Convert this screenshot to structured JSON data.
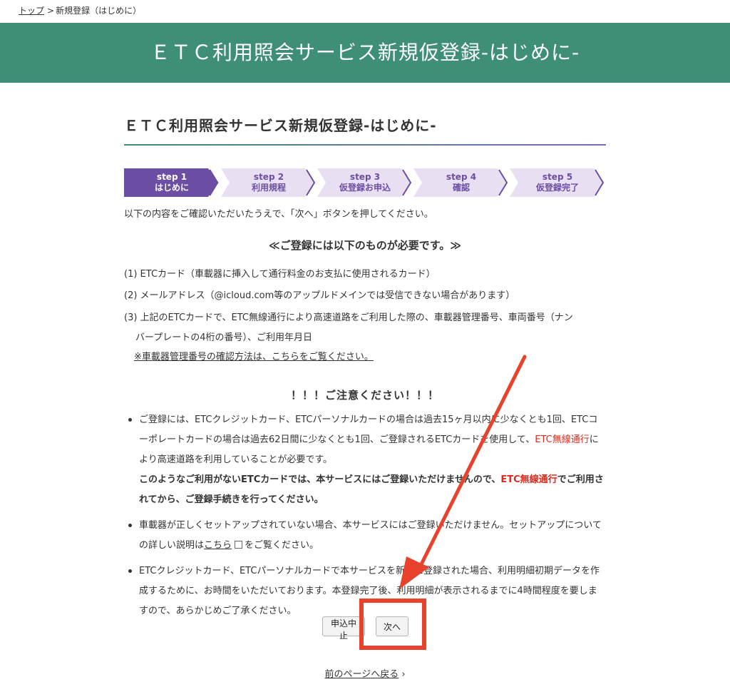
{
  "breadcrumb": {
    "home": "トップ",
    "separator": ">",
    "current": "新規登録（はじめに）"
  },
  "banner": {
    "title": "ＥＴＣ利用照会サービス新規仮登録-はじめに-"
  },
  "page": {
    "title": "ＥＴＣ利用照会サービス新規仮登録-はじめに-"
  },
  "steps": [
    {
      "step": "step 1",
      "label": "はじめに",
      "active": true
    },
    {
      "step": "step 2",
      "label": "利用規程",
      "active": false
    },
    {
      "step": "step 3",
      "label": "仮登録お申込",
      "active": false
    },
    {
      "step": "step 4",
      "label": "確認",
      "active": false
    },
    {
      "step": "step 5",
      "label": "仮登録完了",
      "active": false
    }
  ],
  "intro": "以下の内容をご確認いただいたうえで、「次へ」ボタンを押してください。",
  "requirements": {
    "heading": "≪ご登録には以下のものが必要です。≫",
    "item1": "(1) ETCカード（車載器に挿入して通行料金のお支払に使用されるカード）",
    "item2": "(2) メールアドレス（@icloud.com等のアップルドメインでは受信できない場合があります）",
    "item3_line1": "(3) 上記のETCカードで、ETC無線通行により高速道路をご利用した際の、車載器管理番号、車両番号（ナン",
    "item3_line2": "バープレートの4桁の番号）、ご利用年月日",
    "item3_link": "※車載器管理番号の確認方法は、こちらをご覧ください。"
  },
  "notice": {
    "heading": "！！！ご注意ください！！！",
    "b1_text1": "ご登録には、ETCクレジットカード、ETCパーソナルカードの場合は過去15ヶ月以内に少なくとも1回、ETCコーポレートカードの場合は過去62日間に少なくとも1回、ご登録されるETCカードを使用して、",
    "b1_red1": "ETC無線通行",
    "b1_text2": "により高速道路を利用していることが必要です。",
    "b1_bold1": "このようなご利用がないETCカードでは、本サービスにはご登録いただけませんので、",
    "b1_red2": "ETC無線通行",
    "b1_bold2": "でご利用されてから、ご登録手続きを行ってください。",
    "b2_text1": "車載器が正しくセットアップされていない場合、本サービスにはご登録いただけません。セットアップについての詳しい説明は",
    "b2_link": "こちら",
    "b2_text2": "をご覧ください。",
    "b3_text": "ETCクレジットカード、ETCパーソナルカードで本サービスを新規に登録された場合、利用明細初期データを作成するために、お時間をいただいております。本登録完了後、利用明細が表示されるまでに4時間程度を要しますので、あらかじめご了承ください。"
  },
  "buttons": {
    "cancel": "申込中止",
    "next": "次へ"
  },
  "back_link": "前のページへ戻る",
  "colors": {
    "banner": "#3e8e78",
    "step_active": "#6c4ea4",
    "step_inactive": "#e8e0f2",
    "alert_red": "#e0291c",
    "annotation": "#e8412c"
  }
}
